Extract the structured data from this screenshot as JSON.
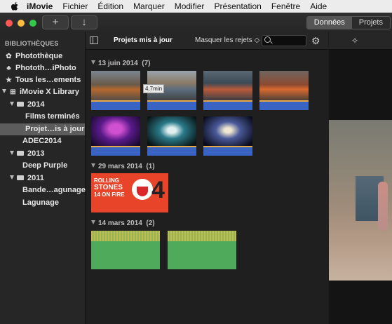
{
  "menubar": {
    "app": "iMovie",
    "items": [
      "Fichier",
      "Édition",
      "Marquer",
      "Modifier",
      "Présentation",
      "Fenêtre",
      "Aide"
    ]
  },
  "toolbar": {
    "add_label": "+",
    "import_label": "↓",
    "segments": [
      "Données",
      "Projets"
    ],
    "selected_segment": "Données"
  },
  "sidebar": {
    "heading": "BIBLIOTHÈQUES",
    "items": [
      {
        "label": "Photothèque",
        "icon": "photos-icon"
      },
      {
        "label": "Phototh…iPhoto",
        "icon": "palm-tree-icon"
      },
      {
        "label": "Tous les…ements",
        "icon": "star-icon"
      },
      {
        "label": "iMovie X Library",
        "icon": "grid-icon"
      },
      {
        "label": "2014"
      },
      {
        "label": "Films terminés"
      },
      {
        "label": "Projet…is à jour"
      },
      {
        "label": "ADEC2014"
      },
      {
        "label": "2013"
      },
      {
        "label": "Deep Purple"
      },
      {
        "label": "2011"
      },
      {
        "label": "Bande…agunage"
      },
      {
        "label": "Lagunage"
      }
    ],
    "selected": "Projet…is à jour"
  },
  "browser": {
    "title": "Projets mis à jour",
    "filter": "Masquer les rejets ◇",
    "search_placeholder": "",
    "tooltip": "4,7min",
    "events": [
      {
        "label": "13 juin 2014",
        "count": "(7)"
      },
      {
        "label": "29 mars 2014",
        "count": "(1)"
      },
      {
        "label": "14 mars 2014",
        "count": "(2)"
      }
    ],
    "poster_lines": [
      "ROLLING",
      "STONES",
      "14 ON FIRE"
    ]
  },
  "colors": {
    "selection": "#5c5c5c",
    "clip_bar": "#3a64c4",
    "audio": "#4faa5c",
    "poster": "#e8442a"
  }
}
